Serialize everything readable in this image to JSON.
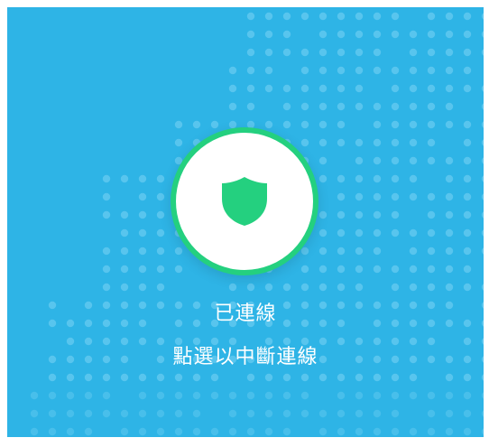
{
  "colors": {
    "background": "#2eb4e6",
    "dot": "#5fc8ee",
    "connected_accent": "#24d07f",
    "text": "#ffffff"
  },
  "connection": {
    "status_label": "已連線",
    "action_hint": "點選以中斷連線",
    "state": "connected"
  },
  "icons": {
    "connect_button": "shield-icon"
  }
}
